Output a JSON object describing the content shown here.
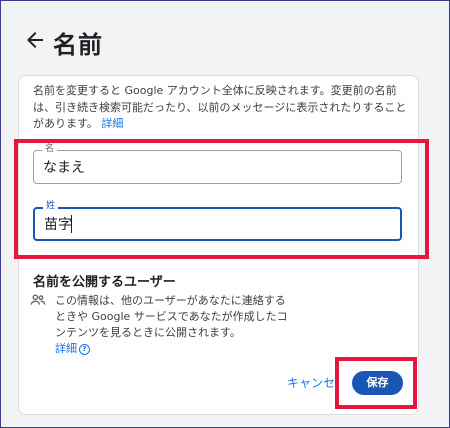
{
  "header": {
    "title": "名前"
  },
  "description": {
    "text": "名前を変更すると Google アカウント全体に反映されます。変更前の名前は、引き続き検索可能だったり、以前のメッセージに表示されたりすることがあります。",
    "link_label": "詳細"
  },
  "form": {
    "first_name": {
      "label": "名",
      "value": "なまえ"
    },
    "last_name": {
      "label": "姓",
      "value": "苗字"
    }
  },
  "visibility": {
    "title": "名前を公開するユーザー",
    "icon": "people-icon",
    "text": "この情報は、他のユーザーがあなたに連絡するときや Google サービスであなたが作成したコンテンツを見るときに公開されます。",
    "link_label": "詳細",
    "help_icon_glyph": "?"
  },
  "actions": {
    "cancel_label": "キャンセル",
    "save_label": "保存"
  },
  "colors": {
    "accent": "#1a56b4",
    "link": "#1a73e8",
    "highlight": "#e6163d",
    "background": "#f1f3f4"
  }
}
